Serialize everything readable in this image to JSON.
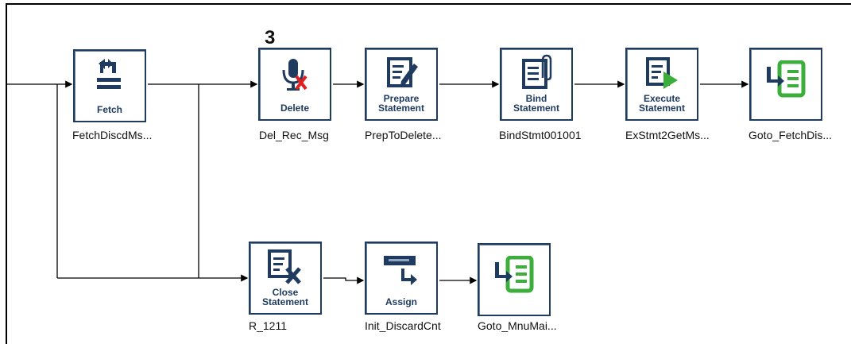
{
  "step_marker": "3",
  "nodes": {
    "fetch": {
      "title": "Fetch",
      "caption": "FetchDiscdMs..."
    },
    "delete": {
      "title": "Delete",
      "caption": "Del_Rec_Msg"
    },
    "prepare": {
      "title": "Prepare\nStatement",
      "caption": "PrepToDelete..."
    },
    "bind": {
      "title": "Bind\nStatement",
      "caption": "BindStmt001001"
    },
    "execute": {
      "title": "Execute\nStatement",
      "caption": "ExStmt2GetMs..."
    },
    "goto1": {
      "title": "",
      "caption": "Goto_FetchDis..."
    },
    "close": {
      "title": "Close\nStatement",
      "caption": "R_1211"
    },
    "assign": {
      "title": "Assign",
      "caption": "Init_DiscardCnt"
    },
    "goto2": {
      "title": "",
      "caption": "Goto_MnuMai..."
    }
  },
  "icons": {
    "fetch": "return-arrow-icon",
    "delete": "mic-delete-icon",
    "prepare": "document-edit-icon",
    "bind": "document-paperclip-icon",
    "execute": "document-play-icon",
    "goto": "goto-list-icon",
    "close": "document-close-icon",
    "assign": "assign-arrow-icon"
  },
  "colors": {
    "navy": "#1f3b60",
    "green": "#3cae3c",
    "red": "#e02020"
  }
}
